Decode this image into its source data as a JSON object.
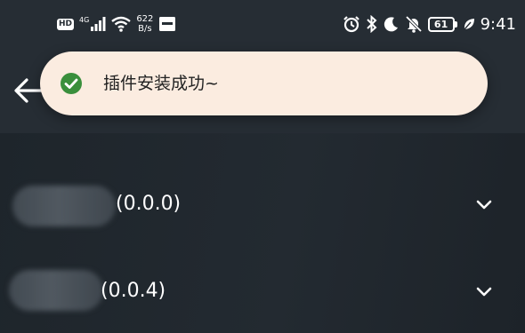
{
  "status_bar": {
    "hd_label": "HD",
    "network_type": "4G",
    "net_speed_value": "622",
    "net_speed_unit": "B/s",
    "battery_level": "61",
    "time": "9:41"
  },
  "toast": {
    "message": "插件安装成功~",
    "icon": "check-circle-icon",
    "accent_color": "#3a8f3c",
    "background_color": "#fbece0"
  },
  "plugins": [
    {
      "name_blurred": true,
      "version": "(0.0.0)",
      "expanded": false
    },
    {
      "name_blurred": true,
      "version": "(0.0.4)",
      "expanded": false
    }
  ]
}
